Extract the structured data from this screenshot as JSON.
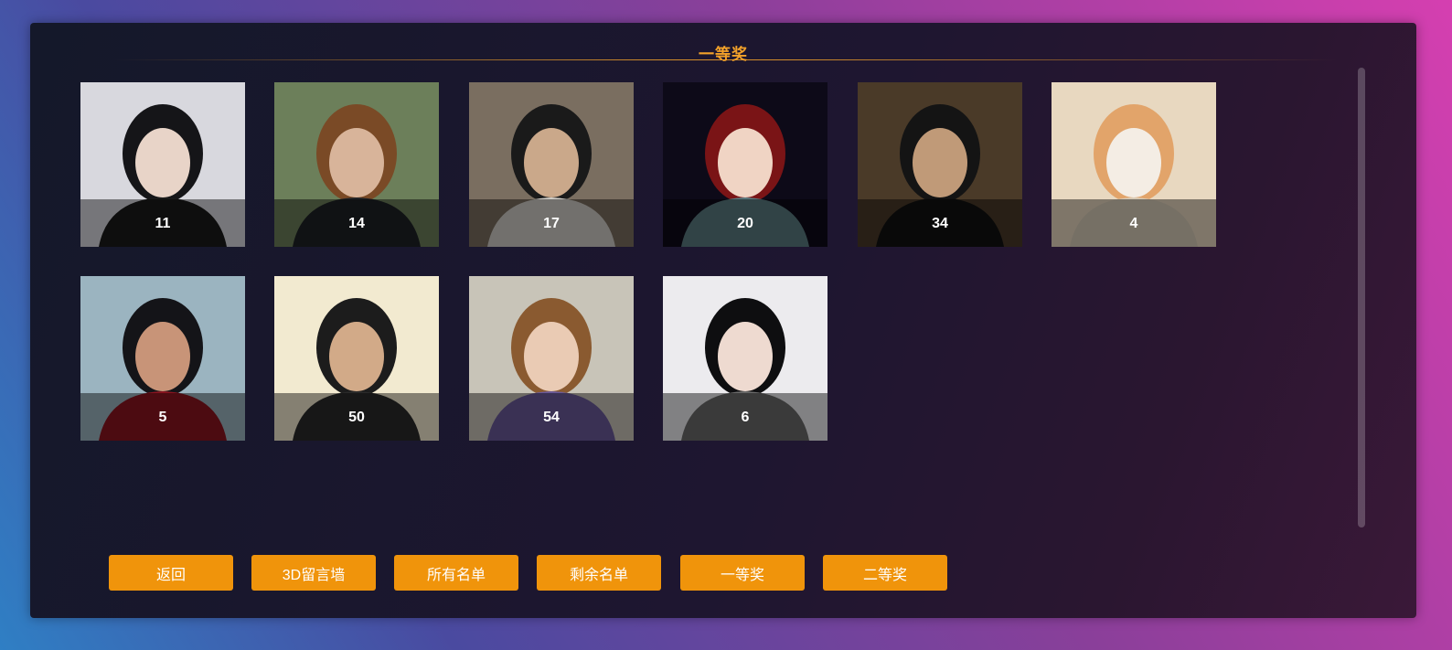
{
  "header": {
    "title": "一等奖"
  },
  "winners": [
    {
      "number": "11",
      "bg": "#d8d8de",
      "hair": "#151518",
      "skin": "#e8d4c8",
      "cloth": "#1a1a1a"
    },
    {
      "number": "14",
      "bg": "#6c7f5a",
      "hair": "#7a4a26",
      "skin": "#d8b49a",
      "cloth": "#1e2226"
    },
    {
      "number": "17",
      "bg": "#7a6e60",
      "hair": "#1a1a1a",
      "skin": "#caa88a",
      "cloth": "#d0ccc6"
    },
    {
      "number": "20",
      "bg": "#0d0a18",
      "hair": "#7a1416",
      "skin": "#f0d4c4",
      "cloth": "#5a7a80"
    },
    {
      "number": "34",
      "bg": "#4a3a28",
      "hair": "#141414",
      "skin": "#c09a78",
      "cloth": "#121212"
    },
    {
      "number": "4",
      "bg": "#e8d8c0",
      "hair": "#e2a46a",
      "skin": "#f4ede4",
      "cloth": "#d8ccb8"
    },
    {
      "number": "5",
      "bg": "#9bb4c0",
      "hair": "#141418",
      "skin": "#c89478",
      "cloth": "#8a1420"
    },
    {
      "number": "50",
      "bg": "#f2ead0",
      "hair": "#1c1c1c",
      "skin": "#d2aa88",
      "cloth": "#2a2a2a"
    },
    {
      "number": "54",
      "bg": "#c8c4b8",
      "hair": "#8a5a30",
      "skin": "#eacbb4",
      "cloth": "#6a5a9a"
    },
    {
      "number": "6",
      "bg": "#ecebee",
      "hair": "#0e0e10",
      "skin": "#eedad0",
      "cloth": "#6a6a6a"
    }
  ],
  "buttons": [
    {
      "label": "返回"
    },
    {
      "label": "3D留言墙"
    },
    {
      "label": "所有名单"
    },
    {
      "label": "剩余名单"
    },
    {
      "label": "一等奖"
    },
    {
      "label": "二等奖"
    }
  ],
  "colors": {
    "accent": "#f0940b",
    "title": "#f2a12a"
  }
}
